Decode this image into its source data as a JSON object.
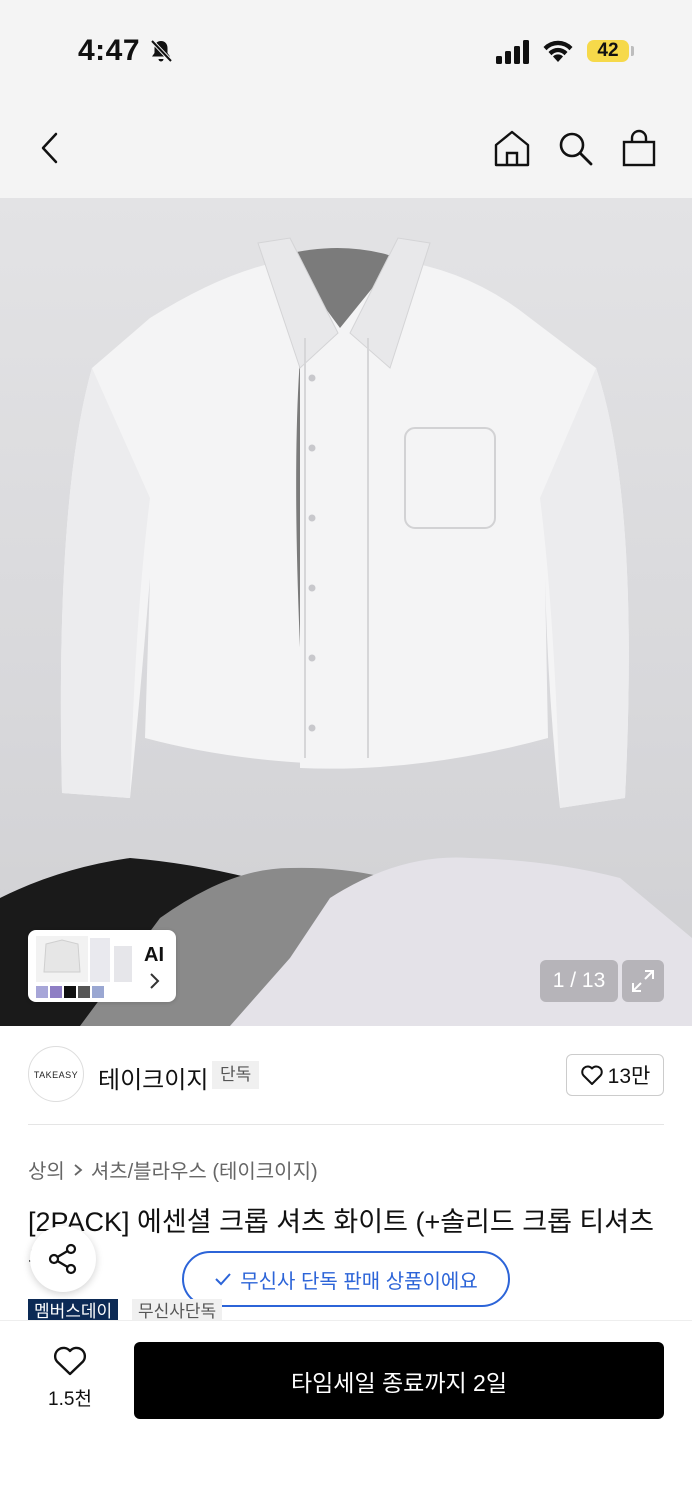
{
  "status_bar": {
    "time": "4:47",
    "battery": "42"
  },
  "hero": {
    "page_counter": "1 / 13",
    "ai_label": "AI"
  },
  "brand": {
    "logo_text": "TAKEASY",
    "name": "테이크이지",
    "exclusive_tag": "단독",
    "like_count": "13만"
  },
  "breadcrumb": {
    "category": "상의",
    "subcategory": "셔츠/블라우스 (테이크이지)"
  },
  "product": {
    "title": "[2PACK] 에센셜 크롭 셔츠 화이트 (+솔리드 크롭 티셔츠 증정)",
    "tags": [
      "멤버스데이",
      "무신사단독"
    ]
  },
  "toast": {
    "text": "무신사 단독 판매 상품이에요"
  },
  "bottom_bar": {
    "like_count": "1.5천",
    "buy_label": "타임세일 종료까지 2일"
  },
  "colors": {
    "accent_blue": "#2c64d8",
    "member_tag_bg": "#0c2a55",
    "battery_yellow": "#f6d94a"
  }
}
